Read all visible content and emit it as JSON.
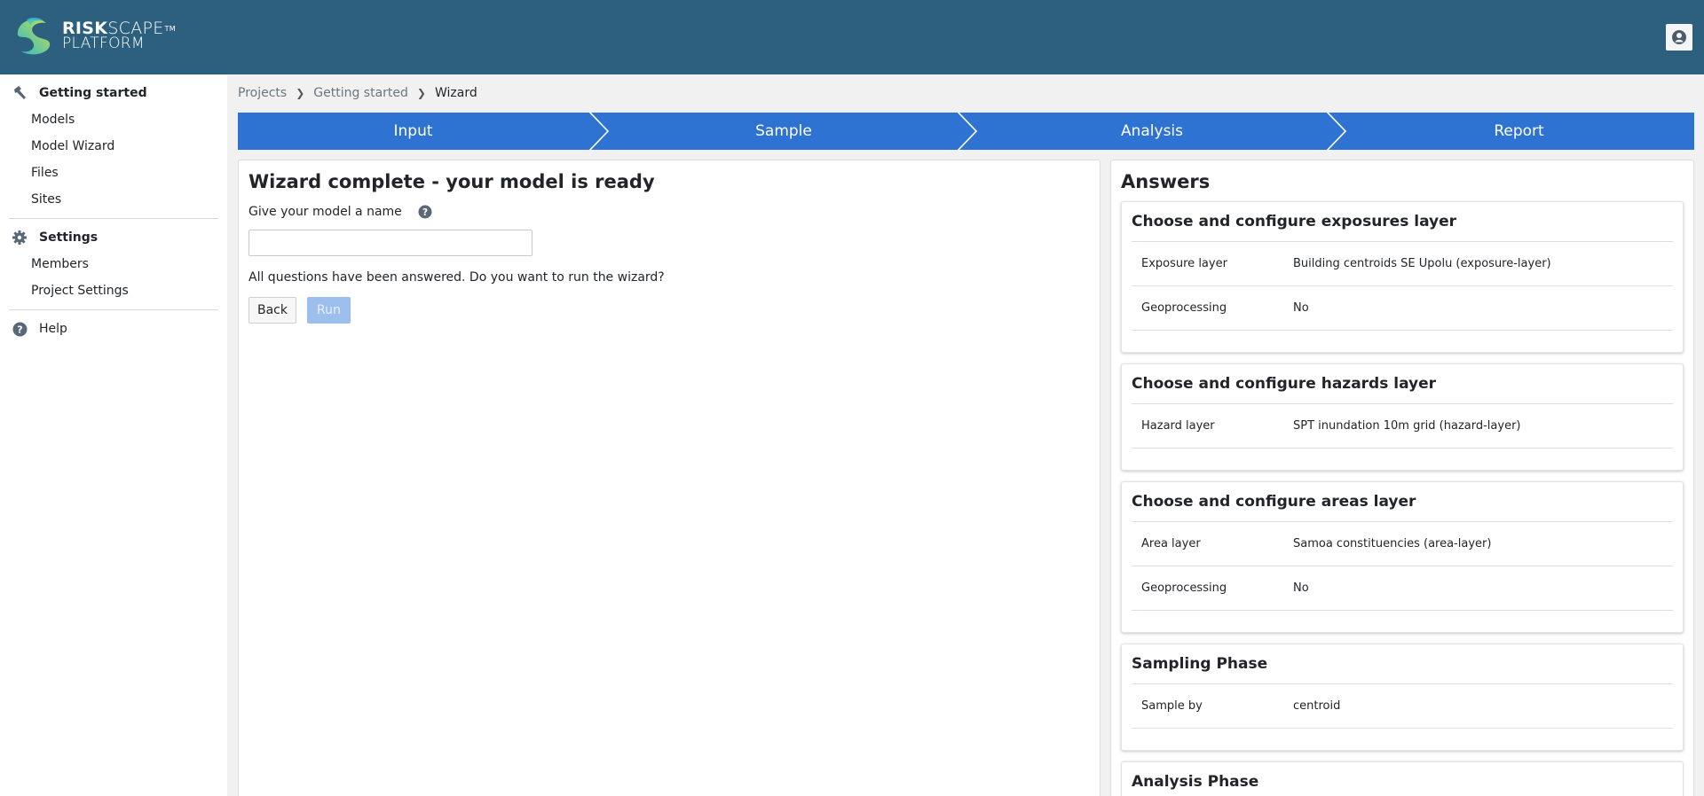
{
  "header": {
    "logo": {
      "word_bold": "RISK",
      "word_thin": "SCAPE",
      "trademark": "TM",
      "line2": "PLATFORM"
    },
    "user_icon": "user-circle-icon"
  },
  "sidebar": {
    "groups": [
      {
        "label": "Getting started",
        "icon": "hammer-icon",
        "items": [
          {
            "label": "Models"
          },
          {
            "label": "Model Wizard"
          },
          {
            "label": "Files"
          },
          {
            "label": "Sites"
          }
        ]
      },
      {
        "label": "Settings",
        "icon": "gear-icon",
        "items": [
          {
            "label": "Members"
          },
          {
            "label": "Project Settings"
          }
        ]
      },
      {
        "label": "Help",
        "icon": "question-circle-icon",
        "items": []
      }
    ]
  },
  "breadcrumb": [
    "Projects",
    "Getting started",
    "Wizard"
  ],
  "stepper": {
    "steps": [
      "Input",
      "Sample",
      "Analysis",
      "Report"
    ],
    "color": "#2e73d2"
  },
  "wizard": {
    "title": "Wizard complete - your model is ready",
    "name_label": "Give your model a name",
    "name_value": "",
    "name_placeholder": "",
    "message": "All questions have been answered. Do you want to run the wizard?",
    "back_label": "Back",
    "run_label": "Run",
    "run_disabled": true
  },
  "answers": {
    "title": "Answers",
    "sections": [
      {
        "title": "Choose and configure exposures layer",
        "rows": [
          {
            "key": "Exposure layer",
            "value": "Building centroids SE Upolu (exposure-layer)"
          },
          {
            "key": "Geoprocessing",
            "value": "No"
          }
        ]
      },
      {
        "title": "Choose and configure hazards layer",
        "rows": [
          {
            "key": "Hazard layer",
            "value": "SPT inundation 10m grid (hazard-layer)"
          }
        ]
      },
      {
        "title": "Choose and configure areas layer",
        "rows": [
          {
            "key": "Area layer",
            "value": "Samoa constituencies (area-layer)"
          },
          {
            "key": "Geoprocessing",
            "value": "No"
          }
        ]
      },
      {
        "title": "Sampling Phase",
        "rows": [
          {
            "key": "Sample by",
            "value": "centroid"
          }
        ]
      },
      {
        "title": "Analysis Phase",
        "rows": []
      }
    ]
  }
}
